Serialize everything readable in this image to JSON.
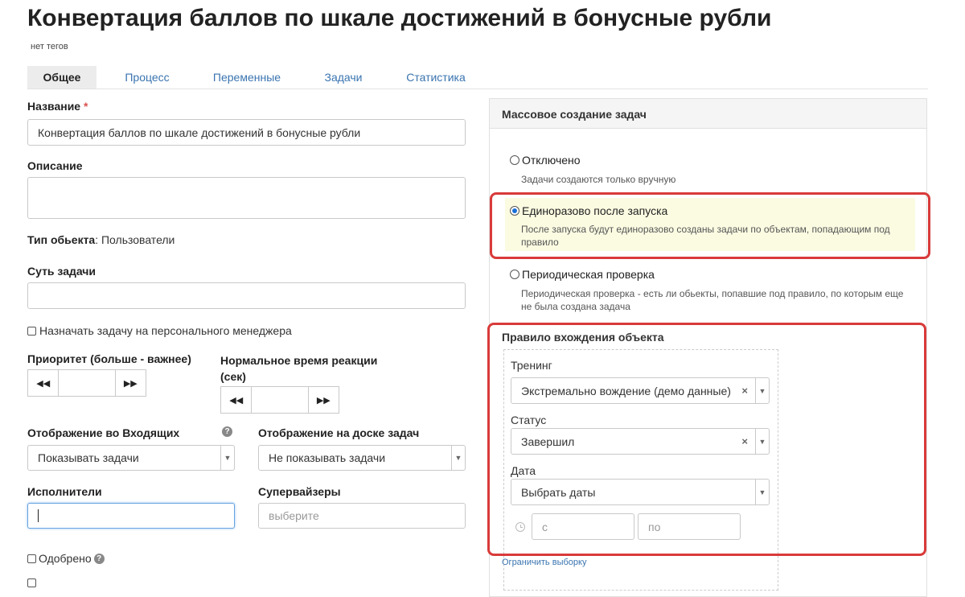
{
  "page": {
    "title": "Конвертация баллов по шкале достижений в бонусные рубли",
    "tags": "нет тегов"
  },
  "tabs": [
    {
      "label": "Общее",
      "active": true
    },
    {
      "label": "Процесс"
    },
    {
      "label": "Переменные"
    },
    {
      "label": "Задачи"
    },
    {
      "label": "Статистика"
    }
  ],
  "form": {
    "name_label": "Название",
    "required_mark": "*",
    "name_value": "Конвертация баллов по шкале достижений в бонусные рубли",
    "description_label": "Описание",
    "description_value": "",
    "object_type_label": "Тип обьекта",
    "object_type_value": ": Пользователи",
    "task_essence_label": "Суть задачи",
    "task_essence_value": "",
    "assign_manager_label": "Назначать задачу на персонального менеджера",
    "priority_label": "Приоритет (больше - важнее)",
    "priority_value": "",
    "reaction_time_label": "Нормальное время реакции (сек)",
    "reaction_time_value": "",
    "inbox_display_label": "Отображение во Входящих",
    "inbox_display_value": "Показывать задачи",
    "board_display_label": "Отображение на доске задач",
    "board_display_value": "Не показывать задачи",
    "executors_label": "Исполнители",
    "executors_value": "",
    "supervisors_label": "Супервайзеры",
    "supervisors_placeholder": "выберите",
    "approved_label": "Одобрено",
    "help_glyph": "?",
    "step_prev": "◀◀",
    "step_next": "▶▶"
  },
  "mass_creation": {
    "title": "Массовое создание задач",
    "options": [
      {
        "label": "Отключено",
        "desc": "Задачи создаются только вручную",
        "selected": false
      },
      {
        "label": "Единоразово после запуска",
        "desc": "После запуска будут единоразово созданы задачи по объектам, попадающим под правило",
        "selected": true
      },
      {
        "label": "Периодическая проверка",
        "desc": "Периодическая проверка - есть ли обьекты, попавшие под правило, по которым еще не была создана задача",
        "selected": false
      }
    ]
  },
  "rule": {
    "title": "Правило вхождения объекта",
    "training_label": "Тренинг",
    "training_value": "Экстремально вождение (демо данные)",
    "status_label": "Статус",
    "status_value": "Завершил",
    "date_label": "Дата",
    "date_value": "Выбрать даты",
    "from_placeholder": "с",
    "to_placeholder": "по",
    "limit_link": "Ограничить выборку",
    "clear_glyph": "×",
    "arrow_glyph": "▼"
  },
  "colors": {
    "highlight": "#d93a3a",
    "link": "#3a74b0",
    "selected_bg": "#fbfbe2",
    "radio_on": "#1a6fd6"
  }
}
